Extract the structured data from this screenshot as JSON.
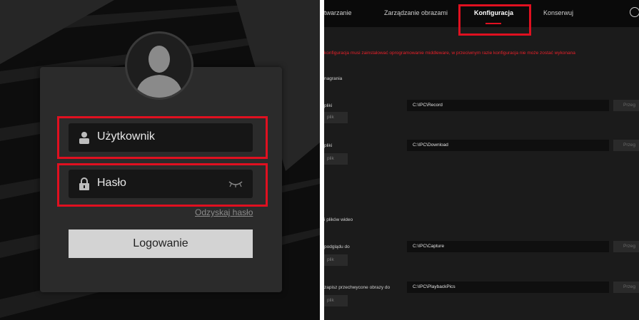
{
  "login": {
    "username_placeholder": "Użytkownik",
    "password_placeholder": "Hasło",
    "recover_link": "Odzyskaj hasło",
    "login_button": "Logowanie"
  },
  "config": {
    "tabs": [
      {
        "label": "twarzanie"
      },
      {
        "label": "Zarządzanie obrazami"
      },
      {
        "label": "Konfiguracja"
      },
      {
        "label": "Konserwuj"
      }
    ],
    "warning": "konfiguracja musi zainstalować oprogramowanie middleware, w przeciwnym razie konfiguracja nie może zostać wykonana",
    "section_recording": "nagrania",
    "section_video": "i plików wideo",
    "rows": [
      {
        "label": "pliki",
        "path": "C:\\IPC\\Record",
        "browse": "Przeg",
        "open": "plik"
      },
      {
        "label": "pliki",
        "path": "C:\\IPC\\Download",
        "browse": "Przeg",
        "open": "plik"
      },
      {
        "label": "podglądu do",
        "path": "C:\\IPC\\Capture",
        "browse": "Przeg",
        "open": "plik"
      },
      {
        "label": "zapisz przechwycone obrazy do",
        "path": "C:\\IPC\\PlaybackPics",
        "browse": "Przeg",
        "open": "plik"
      }
    ]
  },
  "colors": {
    "highlight": "#e01020",
    "active_underline": "#e01020",
    "warning_text": "#e8202a"
  }
}
